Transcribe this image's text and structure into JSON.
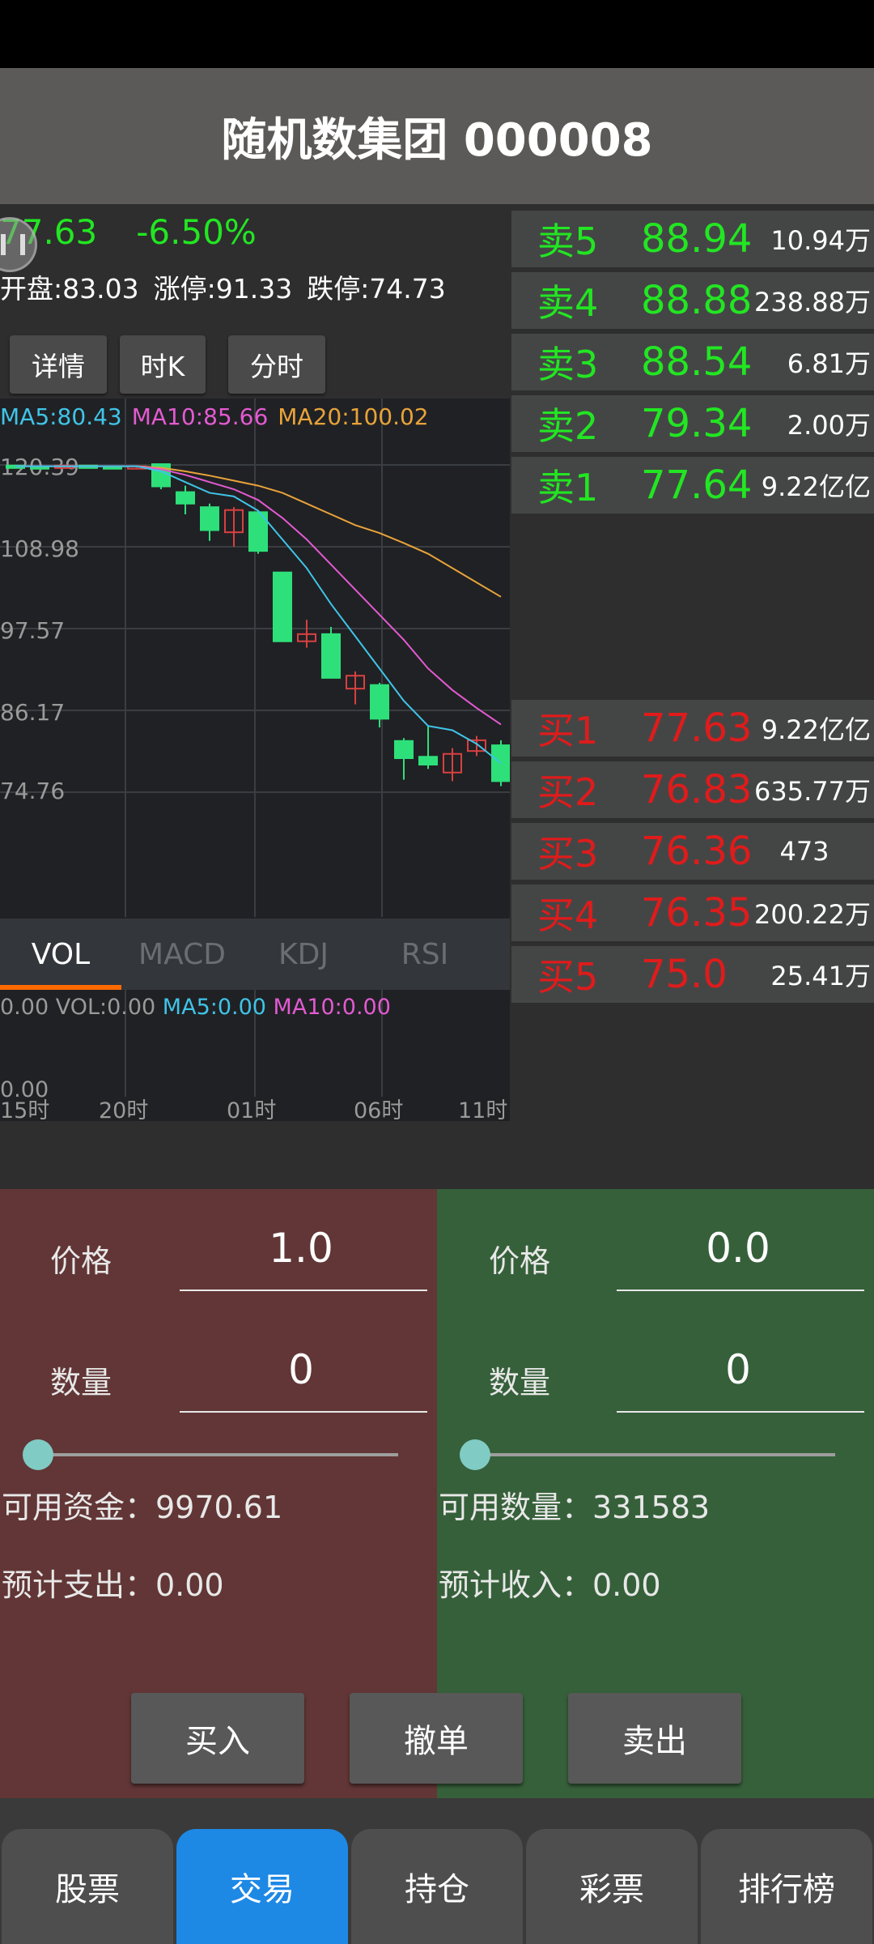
{
  "title": "随机数集团 000008",
  "quote": {
    "price": "77.63",
    "change_pct": "-6.50%",
    "open": "开盘:83.03",
    "limit_up": "涨停:91.33",
    "limit_down": "跌停:74.73"
  },
  "tabs": [
    "详情",
    "时K",
    "分时"
  ],
  "ma_legend": {
    "ma5": "MA5:80.43",
    "ma10": "MA10:85.66",
    "ma20": "MA20:100.02",
    "ma5_color": "#3fc4e8",
    "ma10_color": "#e35ad2",
    "ma20_color": "#e8a33a"
  },
  "chart_data": {
    "type": "candlestick",
    "y_ticks": [
      "120.39",
      "108.98",
      "97.57",
      "86.17",
      "74.76"
    ],
    "ylim": [
      74.76,
      120.39
    ],
    "x_ticks": [
      "15时",
      "20时",
      "01时",
      "06时",
      "11时"
    ],
    "candles": [
      {
        "o": 120.3,
        "c": 120.2,
        "h": 120.4,
        "l": 120.0
      },
      {
        "o": 120.2,
        "c": 120.1,
        "h": 120.3,
        "l": 120.0
      },
      {
        "o": 120.1,
        "c": 120.3,
        "h": 120.4,
        "l": 120.0
      },
      {
        "o": 120.3,
        "c": 120.2,
        "h": 120.4,
        "l": 120.1
      },
      {
        "o": 120.2,
        "c": 120.1,
        "h": 120.3,
        "l": 120.0
      },
      {
        "o": 120.1,
        "c": 120.2,
        "h": 120.3,
        "l": 120.0
      },
      {
        "o": 120.5,
        "c": 117.4,
        "h": 120.5,
        "l": 117.0
      },
      {
        "o": 116.6,
        "c": 115.0,
        "h": 117.5,
        "l": 113.5
      },
      {
        "o": 114.5,
        "c": 111.3,
        "h": 115.0,
        "l": 109.8
      },
      {
        "o": 111.0,
        "c": 114.1,
        "h": 114.5,
        "l": 109.0
      },
      {
        "o": 113.8,
        "c": 108.4,
        "h": 114.0,
        "l": 108.0
      },
      {
        "o": 105.4,
        "c": 95.8,
        "h": 105.4,
        "l": 95.8
      },
      {
        "o": 95.8,
        "c": 96.8,
        "h": 98.8,
        "l": 94.9
      },
      {
        "o": 96.8,
        "c": 90.7,
        "h": 97.8,
        "l": 90.7
      },
      {
        "o": 89.2,
        "c": 91.0,
        "h": 91.6,
        "l": 87.0
      },
      {
        "o": 89.7,
        "c": 85.0,
        "h": 90.0,
        "l": 83.8
      },
      {
        "o": 81.9,
        "c": 79.5,
        "h": 82.3,
        "l": 76.5
      },
      {
        "o": 79.7,
        "c": 78.6,
        "h": 84.0,
        "l": 78.0
      },
      {
        "o": 77.5,
        "c": 80.1,
        "h": 80.9,
        "l": 76.3
      },
      {
        "o": 80.5,
        "c": 82.0,
        "h": 82.6,
        "l": 79.8
      },
      {
        "o": 81.3,
        "c": 76.3,
        "h": 82.0,
        "l": 75.6
      }
    ],
    "ma5": [
      120.2,
      120.2,
      120.2,
      120.2,
      120.2,
      120.2,
      119.5,
      118.0,
      116.5,
      116.0,
      114.0,
      110.0,
      106.0,
      101.0,
      96.5,
      92.0,
      87.5,
      84.0,
      83.4,
      81.5,
      78.8
    ],
    "ma10": [
      120.2,
      120.2,
      120.2,
      120.2,
      120.2,
      120.2,
      119.8,
      119.0,
      118.0,
      117.0,
      115.5,
      113.0,
      110.0,
      106.5,
      103.0,
      99.5,
      96.0,
      92.0,
      89.0,
      86.5,
      84.2
    ],
    "ma20": [
      120.2,
      120.2,
      120.2,
      120.2,
      120.2,
      120.2,
      120.0,
      119.5,
      118.9,
      118.2,
      117.5,
      116.5,
      115.0,
      113.5,
      112.0,
      110.9,
      109.5,
      108.0,
      106.0,
      104.0,
      102.0
    ],
    "up_color": "#d94040",
    "down_color": "#2ee07a"
  },
  "indicator_tabs": [
    "VOL",
    "MACD",
    "KDJ",
    "RSI"
  ],
  "volume_legend": {
    "vol": "0.00 VOL:0.00",
    "ma5": "MA5:0.00",
    "ma10": "MA10:0.00",
    "axis_bottom": "0.00"
  },
  "order_book": {
    "sells": [
      {
        "label": "卖5",
        "price": "88.94",
        "volume": "10.94万"
      },
      {
        "label": "卖4",
        "price": "88.88",
        "volume": "238.88万"
      },
      {
        "label": "卖3",
        "price": "88.54",
        "volume": "6.81万"
      },
      {
        "label": "卖2",
        "price": "79.34",
        "volume": "2.00万"
      },
      {
        "label": "卖1",
        "price": "77.64",
        "volume": "9.22亿亿"
      }
    ],
    "buys": [
      {
        "label": "买1",
        "price": "77.63",
        "volume": "9.22亿亿"
      },
      {
        "label": "买2",
        "price": "76.83",
        "volume": "635.77万"
      },
      {
        "label": "买3",
        "price": "76.36",
        "volume": "473"
      },
      {
        "label": "买4",
        "price": "76.35",
        "volume": "200.22万"
      },
      {
        "label": "买5",
        "price": "75.0",
        "volume": "25.41万"
      }
    ]
  },
  "buy_form": {
    "price_label": "价格",
    "price_value": "1.0",
    "qty_label": "数量",
    "qty_value": "0",
    "slider_level": 0,
    "available": "可用资金：9970.61",
    "estimate": "预计支出：0.00"
  },
  "sell_form": {
    "price_label": "价格",
    "price_value": "0.0",
    "qty_label": "数量",
    "qty_value": "0",
    "slider_level": 0,
    "available": "可用数量：331583",
    "estimate": "预计收入：0.00"
  },
  "actions": {
    "buy": "买入",
    "cancel": "撤单",
    "sell": "卖出"
  },
  "nav": [
    "股票",
    "交易",
    "持仓",
    "彩票",
    "排行榜"
  ],
  "nav_active": "交易"
}
